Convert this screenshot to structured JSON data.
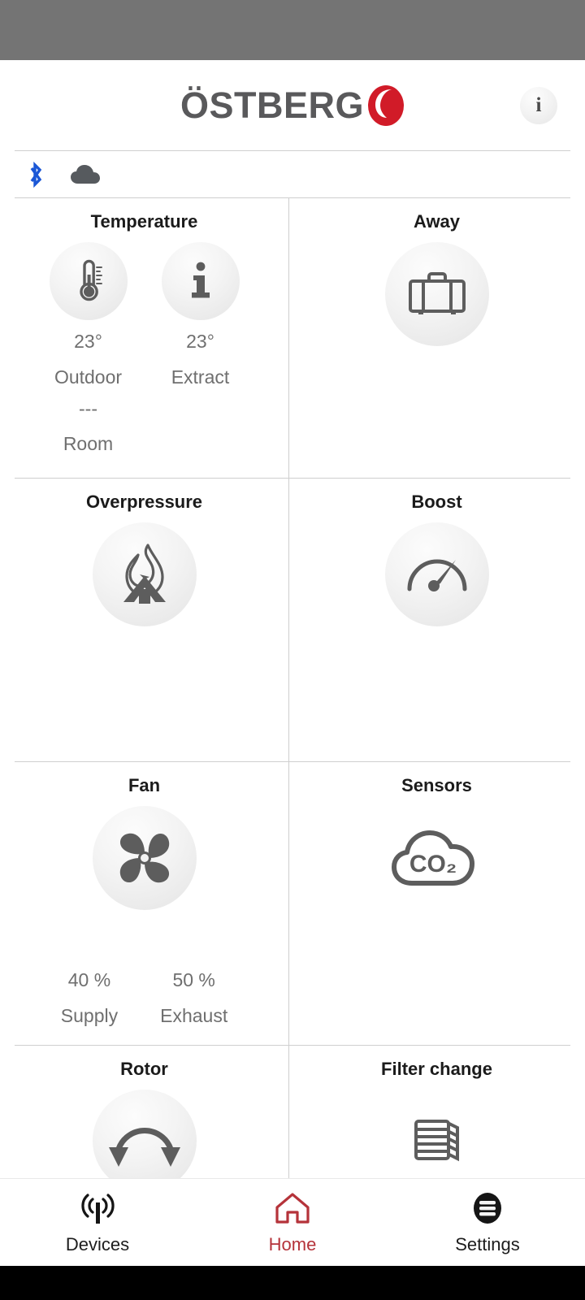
{
  "brand": {
    "wordmark": "ÖSTBERG",
    "logo_color": "#d11b28",
    "wordmark_color": "#59595b",
    "logo_mark_icon": "ostberg-drop-logo"
  },
  "header": {
    "info_button_label": "i",
    "info_button_icon": "info-icon"
  },
  "status_strip": {
    "icons": [
      {
        "name": "bluetooth-icon",
        "color": "#1b57d6",
        "label": "Bluetooth"
      },
      {
        "name": "cloud-icon",
        "color": "#565a5e",
        "label": "Cloud"
      }
    ]
  },
  "cards": {
    "temperature": {
      "title": "Temperature",
      "outdoor": {
        "icon": "thermometer-icon",
        "value": "23°",
        "label": "Outdoor"
      },
      "extract": {
        "icon": "info-icon",
        "value": "23°",
        "label": "Extract"
      },
      "room": {
        "value": "---",
        "label": "Room"
      }
    },
    "away": {
      "title": "Away",
      "icon": "briefcase-icon"
    },
    "overpressure": {
      "title": "Overpressure",
      "icon": "fireplace-icon"
    },
    "boost": {
      "title": "Boost",
      "icon": "speedometer-icon"
    },
    "fan": {
      "title": "Fan",
      "icon": "fan-blade-icon",
      "supply": {
        "value": "40 %",
        "label": "Supply"
      },
      "exhaust": {
        "value": "50 %",
        "label": "Exhaust"
      }
    },
    "sensors": {
      "title": "Sensors",
      "icon": "co2-cloud-icon",
      "icon_text": "CO₂"
    },
    "rotor": {
      "title": "Rotor",
      "icon": "rotation-arrow-icon"
    },
    "filter_change": {
      "title": "Filter change",
      "icon": "filter-stack-icon"
    }
  },
  "bottom_nav": {
    "active": "Home",
    "active_color": "#b5333a",
    "items": [
      {
        "label": "Devices",
        "icon": "antenna-signal-icon"
      },
      {
        "label": "Home",
        "icon": "house-icon"
      },
      {
        "label": "Settings",
        "icon": "menu-circle-icon"
      }
    ]
  }
}
